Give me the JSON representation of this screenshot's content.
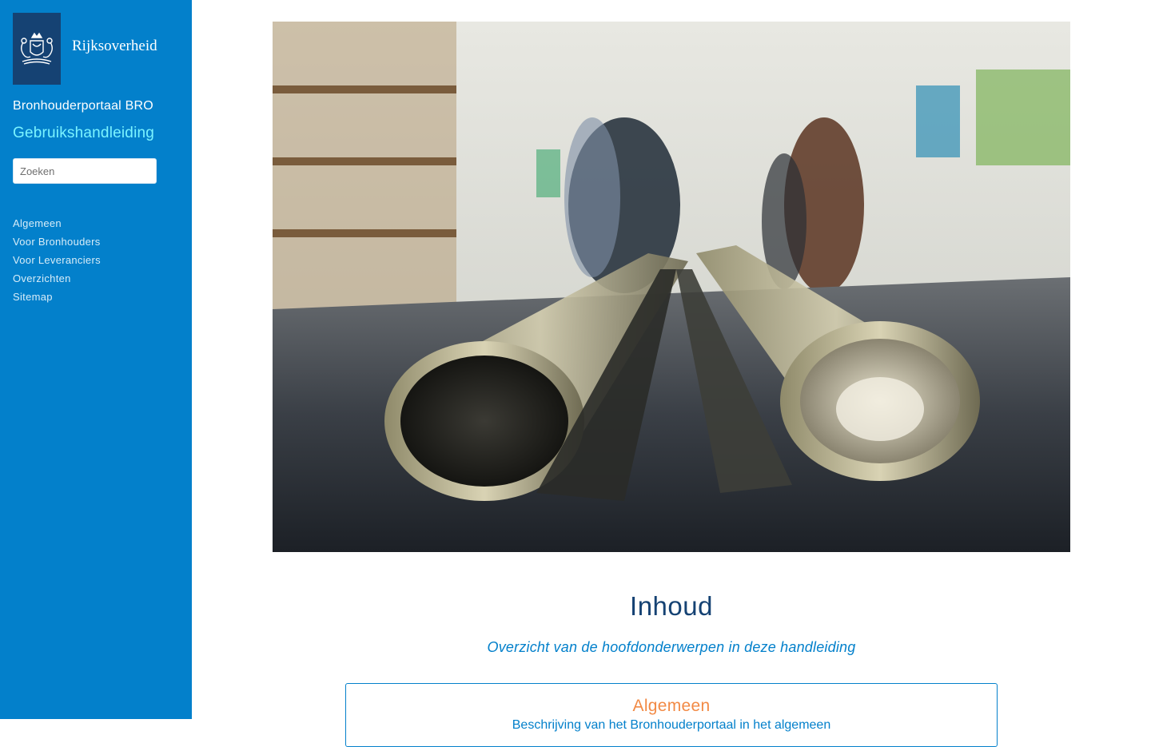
{
  "sidebar": {
    "logo_text": "Rijksoverheid",
    "portal_title": "Bronhouderportaal BRO",
    "manual_title": "Gebruikshandleiding",
    "search_placeholder": "Zoeken",
    "nav": [
      {
        "label": "Algemeen"
      },
      {
        "label": "Voor Bronhouders"
      },
      {
        "label": "Voor Leveranciers"
      },
      {
        "label": "Overzichten"
      },
      {
        "label": "Sitemap"
      }
    ]
  },
  "main": {
    "hero_icon": "soil-core-samples-photo",
    "title": "Inhoud",
    "subtitle": "Overzicht van de hoofdonderwerpen in deze handleiding",
    "cards": [
      {
        "title": "Algemeen",
        "description": "Beschrijving van het Bronhouderportaal in het algemeen"
      }
    ]
  },
  "colors": {
    "sidebar_bg": "#0380cb",
    "logo_bg": "#154273",
    "accent_cyan": "#7bf3ff",
    "title": "#154273",
    "card_title": "#f28a45"
  }
}
